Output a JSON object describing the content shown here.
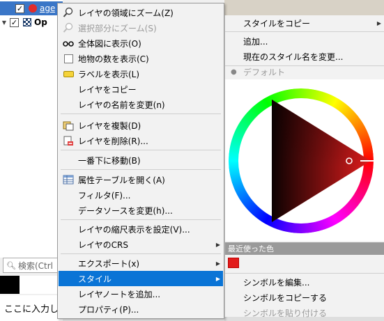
{
  "layers_panel": {
    "rows": [
      {
        "label": "age",
        "selected": true
      },
      {
        "label": "Op",
        "selected": false
      }
    ],
    "search_placeholder": "検索(Ctrl",
    "bottom_input_text": "ここに入力し"
  },
  "context_menu": {
    "items": [
      {
        "label": "レイヤの領域にズーム(Z)",
        "icon": "zoom-layer-icon"
      },
      {
        "label": "選択部分にズーム(S)",
        "icon": "zoom-selection-icon",
        "disabled": true
      },
      {
        "label": "全体図に表示(O)",
        "icon": "glasses-icon"
      },
      {
        "label": "地物の数を表示(C)",
        "icon": "checkbox-icon"
      },
      {
        "label": "ラベルを表示(L)",
        "icon": "label-icon"
      },
      {
        "label": "レイヤをコピー"
      },
      {
        "label": "レイヤの名前を変更(n)"
      },
      {
        "label": "レイヤを複製(D)",
        "icon": "duplicate-layer-icon"
      },
      {
        "label": "レイヤを削除(R)...",
        "icon": "remove-layer-icon"
      },
      {
        "label": "一番下に移動(B)"
      },
      {
        "label": "属性テーブルを開く(A)",
        "icon": "attribute-table-icon"
      },
      {
        "label": "フィルタ(F)..."
      },
      {
        "label": "データソースを変更(h)..."
      },
      {
        "label": "レイヤの縮尺表示を設定(V)..."
      },
      {
        "label": "レイヤのCRS",
        "submenu": true
      },
      {
        "label": "エクスポート(x)",
        "submenu": true
      },
      {
        "label": "スタイル",
        "submenu": true,
        "highlighted": true
      },
      {
        "label": "レイヤノートを追加..."
      },
      {
        "label": "プロパティ(P)..."
      }
    ]
  },
  "style_submenu": {
    "copy_style": "スタイルをコピー",
    "add": "追加...",
    "rename_style": "現在のスタイル名を変更...",
    "default_style": "デフォルト",
    "recent_colors_header": "最近使った色",
    "recent_colors": [
      "#e21c1c"
    ],
    "edit_symbol": "シンボルを編集...",
    "copy_symbol": "シンボルをコピーする",
    "paste_symbol": "シンボルを貼り付ける"
  },
  "current_color": "#e21c1c"
}
